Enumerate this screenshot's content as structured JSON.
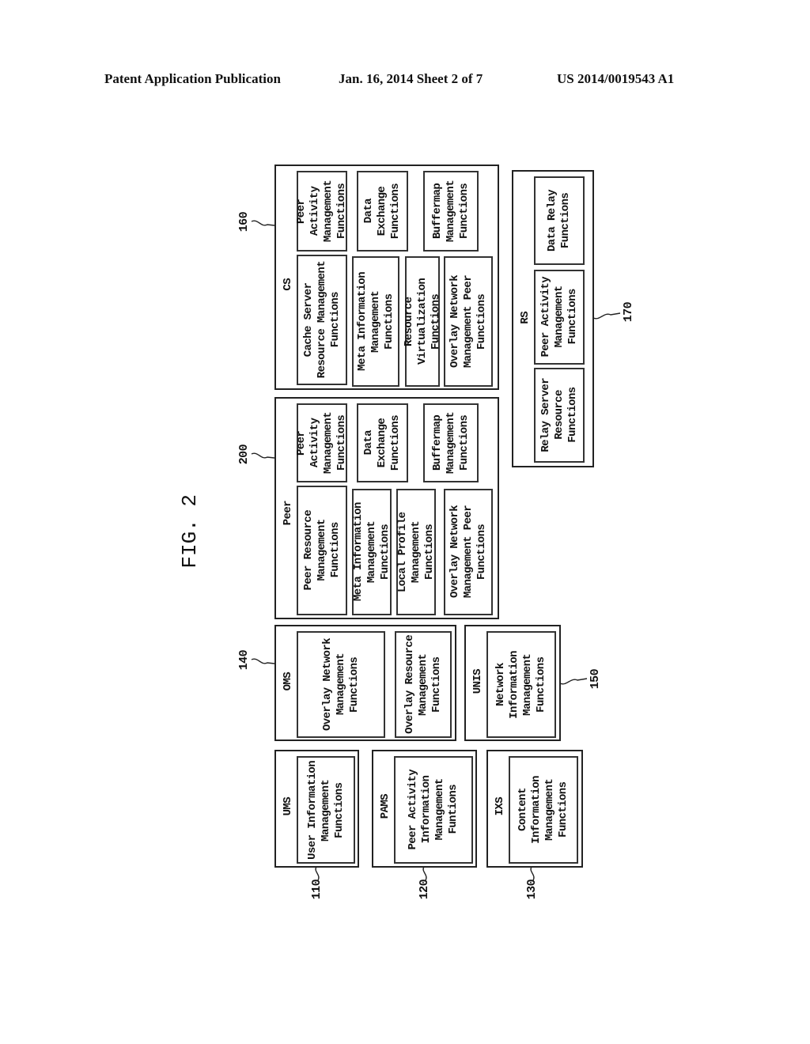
{
  "header": {
    "left": "Patent Application Publication",
    "middle": "Jan. 16, 2014   Sheet 2 of 7",
    "right": "US 2014/0019543 A1"
  },
  "figure_label": "FIG. 2",
  "blocks": {
    "cs": {
      "title": "CS",
      "ref": "160",
      "functions": [
        "Cache Server\nResource Management\nFunctions",
        "Meta Information\nManagement\nFunctions",
        "Resource Virtualization\nFunctions",
        "Overlay Network\nManagement Peer\nFunctions",
        "Peer Activity\nManagement\nFunctions",
        "Data\nExchange\nFunctions",
        "Buffermap\nManagement\nFunctions"
      ]
    },
    "peer": {
      "title": "Peer",
      "ref": "200",
      "functions": [
        "Peer Resource\nManagement\nFunctions",
        "Meta Information\nManagement Functions",
        "Local Profile\nManagement Functions",
        "Overlay Network\nManagement Peer\nFunctions",
        "Peer Activity\nManagement\nFunctions",
        "Data\nExchange\nFunctions",
        "Buffermap\nManagement\nFunctions"
      ]
    },
    "rs": {
      "title": "RS",
      "ref": "170",
      "functions": [
        "Relay Server\nResource\nFunctions",
        "Peer Activity\nManagement\nFunctions",
        "Data Relay\nFunctions"
      ]
    },
    "oms": {
      "title": "OMS",
      "ref": "140",
      "functions": [
        "Overlay Network\nManagement\nFunctions",
        "Overlay Resource\nManagement\nFunctions"
      ]
    },
    "unis": {
      "title": "UNIS",
      "ref": "150",
      "functions": [
        "Network\nInformation\nManagement\nFunctions"
      ]
    },
    "ums": {
      "title": "UMS",
      "ref": "110",
      "functions": [
        "User Information\nManagement\nFunctions"
      ]
    },
    "pams": {
      "title": "PAMS",
      "ref": "120",
      "functions": [
        "Peer Activity\nInformation\nManagement\nFuntions"
      ]
    },
    "ixs": {
      "title": "IXS",
      "ref": "130",
      "functions": [
        "Content\nInformation\nManagement\nFunctions"
      ]
    }
  }
}
